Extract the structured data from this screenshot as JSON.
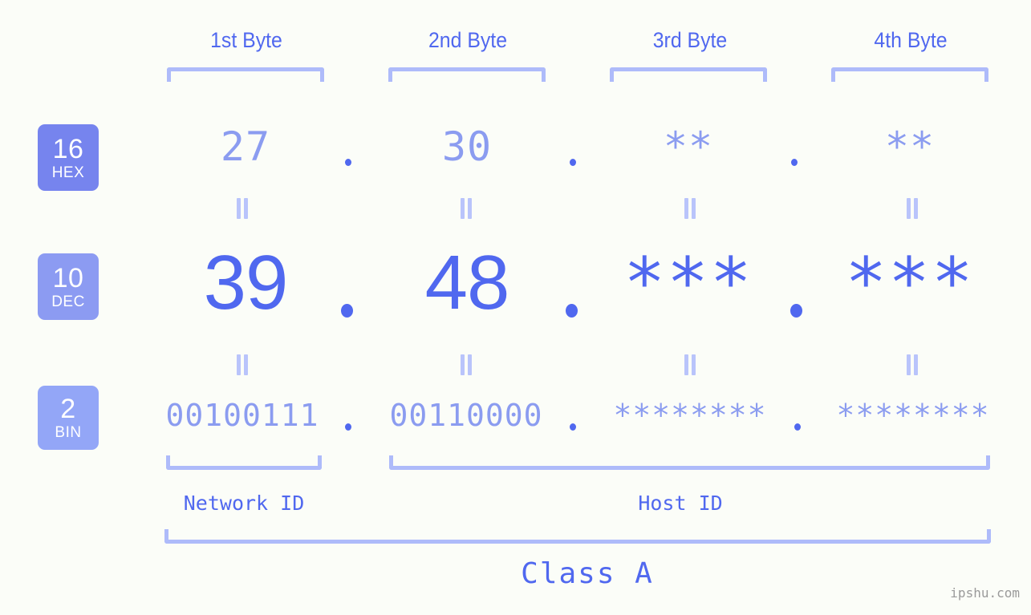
{
  "page": {
    "background": "#fbfdf8",
    "accent": "#5068ef",
    "accent_light": "#8b9cf0",
    "accent_pale": "#aebbfa",
    "watermark": "ipshu.com"
  },
  "byte_headers": [
    {
      "label": "1st Byte"
    },
    {
      "label": "2nd Byte"
    },
    {
      "label": "3rd Byte"
    },
    {
      "label": "4th Byte"
    }
  ],
  "rows": [
    {
      "badge_number": "16",
      "badge_name": "HEX",
      "badge_color": "#7684ee",
      "values": [
        "27",
        "30",
        "**",
        "**"
      ],
      "separator": "."
    },
    {
      "badge_number": "10",
      "badge_name": "DEC",
      "badge_color": "#8c9bf2",
      "values": [
        "39",
        "48",
        "***",
        "***"
      ],
      "separator": "."
    },
    {
      "badge_number": "2",
      "badge_name": "BIN",
      "badge_color": "#93a6f7",
      "values": [
        "00100111",
        "00110000",
        "********",
        "********"
      ],
      "separator": "."
    }
  ],
  "equals_mark": "=",
  "footer": {
    "network_id": "Network ID",
    "host_id": "Host ID",
    "class": "Class A"
  }
}
